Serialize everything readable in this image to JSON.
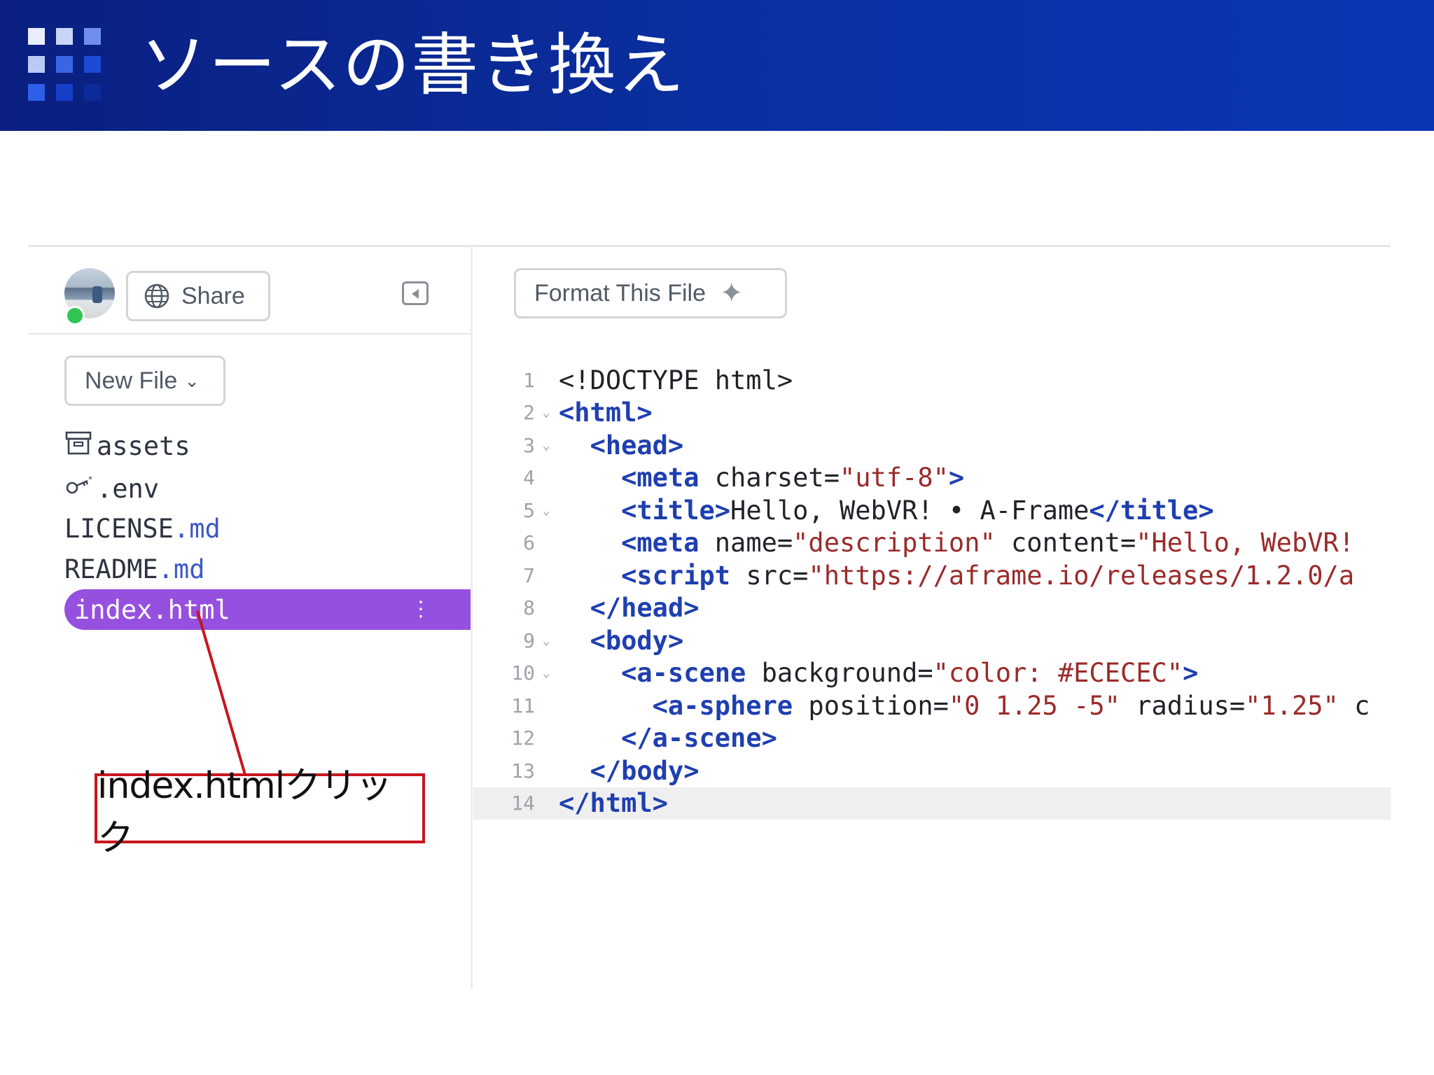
{
  "slide": {
    "title": "ソースの書き換え"
  },
  "sidebar": {
    "share_label": "Share",
    "new_file_label": "New File",
    "files": [
      {
        "name": "assets",
        "ext": "",
        "icon": "archive-box-icon"
      },
      {
        "name": ".env",
        "ext": "",
        "icon": "key-icon"
      },
      {
        "name": "LICENSE",
        "ext": ".md",
        "icon": ""
      },
      {
        "name": "README",
        "ext": ".md",
        "icon": ""
      }
    ],
    "selected_file": "index.html"
  },
  "editor": {
    "format_label": "Format This File",
    "active_line": 14,
    "lines": [
      {
        "n": "1",
        "fold": false
      },
      {
        "n": "2",
        "fold": true
      },
      {
        "n": "3",
        "fold": true
      },
      {
        "n": "4",
        "fold": false
      },
      {
        "n": "5",
        "fold": true
      },
      {
        "n": "6",
        "fold": false
      },
      {
        "n": "7",
        "fold": false
      },
      {
        "n": "8",
        "fold": false
      },
      {
        "n": "9",
        "fold": true
      },
      {
        "n": "10",
        "fold": true
      },
      {
        "n": "11",
        "fold": false
      },
      {
        "n": "12",
        "fold": false
      },
      {
        "n": "13",
        "fold": false
      },
      {
        "n": "14",
        "fold": false
      }
    ],
    "code": {
      "l1": "<!DOCTYPE html>",
      "l2_tag": "<html>",
      "l3_tag": "<head>",
      "l4_tag_open": "<meta",
      "l4_attr": " charset=",
      "l4_str": "\"utf-8\"",
      "l4_tag_close": ">",
      "l5_tag_open": "<title>",
      "l5_text": "Hello, WebVR! • A-Frame",
      "l5_tag_close": "</title>",
      "l6_tag_open": "<meta",
      "l6_attr1": " name=",
      "l6_str1": "\"description\"",
      "l6_attr2": " content=",
      "l6_str2": "\"Hello, WebVR!",
      "l7_tag_open": "<script",
      "l7_attr": " src=",
      "l7_str": "\"https://aframe.io/releases/1.2.0/a",
      "l8_tag": "</head>",
      "l9_tag": "<body>",
      "l10_tag_open": "<a-scene",
      "l10_attr": " background=",
      "l10_str": "\"color: #ECECEC\"",
      "l10_tag_close": ">",
      "l11_tag_open": "<a-sphere",
      "l11_attr1": " position=",
      "l11_str1": "\"0 1.25 -5\"",
      "l11_attr2": " radius=",
      "l11_str2": "\"1.25\"",
      "l11_trail": " c",
      "l12_tag": "</a-scene>",
      "l13_tag": "</body>",
      "l14_tag": "</html>"
    }
  },
  "annotation": {
    "callout_text": "index.htmlクリック"
  },
  "colors": {
    "header_bg": "#0a2a9a",
    "selected_bg": "#9650e0",
    "tag": "#1f3fb0",
    "string": "#9b2a2a",
    "callout_border": "#c8151c"
  }
}
